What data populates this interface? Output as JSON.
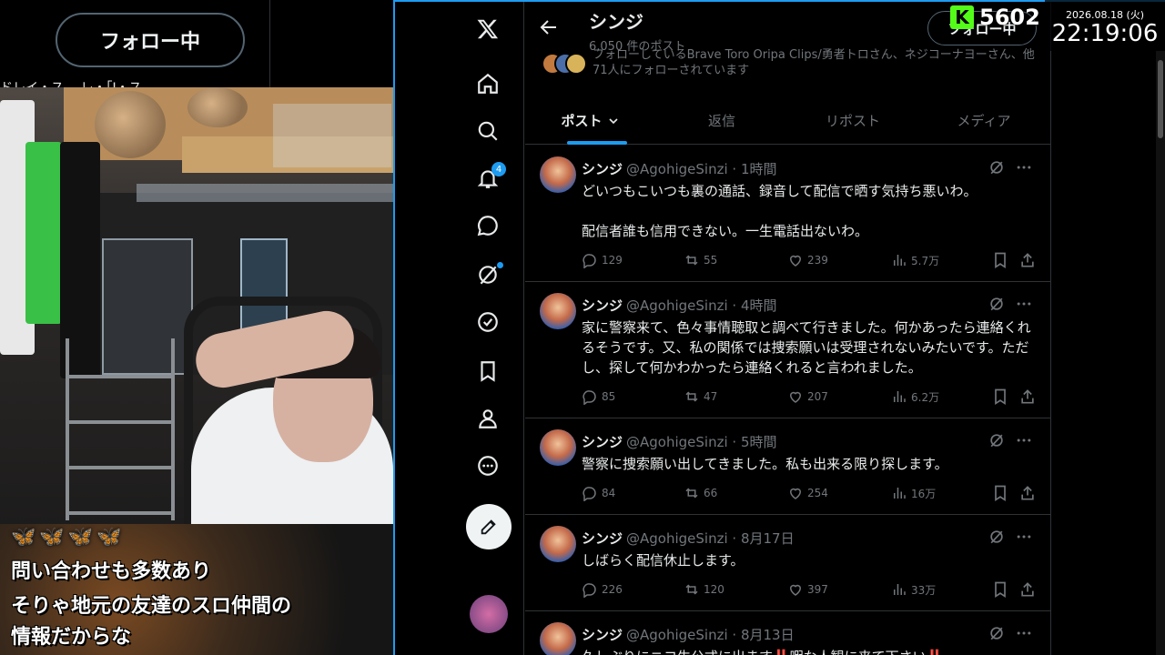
{
  "left_overlay": {
    "follow_label": "フォロー中",
    "cut_text": "ドレイ・ス… レ・「Ⅰ・ス"
  },
  "caption": {
    "icons": "🦋🦋🦋🦋",
    "lines": [
      "問い合わせも多数あり",
      "そりゃ地元の友達のスロ仲間の",
      "情報だからな"
    ]
  },
  "nav": {
    "notifications_badge": "4",
    "icons": [
      "x-logo-icon",
      "home-icon",
      "search-icon",
      "bell-icon",
      "message-icon",
      "grok-icon",
      "verified-icon",
      "bookmark-icon",
      "profile-icon",
      "more-icon"
    ]
  },
  "profile": {
    "name": "シンジ",
    "post_count": "6,050 件のポスト",
    "followed_by": "フォローしているBrave Toro Oripa Clips/勇者トロさん、ネジコーナヨーさん、他71人にフォローされています",
    "follow_button": "フォロー中"
  },
  "tabs": [
    {
      "label": "ポスト",
      "active": true
    },
    {
      "label": "返信",
      "active": false
    },
    {
      "label": "リポスト",
      "active": false
    },
    {
      "label": "メディア",
      "active": false
    }
  ],
  "tweets": [
    {
      "name": "シンジ",
      "meta": "@AgohigeSinzi · 1時間",
      "text": "どいつもこいつも裏の通話、録音して配信で晒す気持ち悪いわ。\n\n配信者誰も信用できない。一生電話出ないわ。",
      "replies": "129",
      "reposts": "55",
      "likes": "239",
      "views": "5.7万"
    },
    {
      "name": "シンジ",
      "meta": "@AgohigeSinzi · 4時間",
      "text": "家に警察来て、色々事情聴取と調べて行きました。何かあったら連絡くれるそうです。又、私の関係では捜索願いは受理されないみたいです。ただし、探して何かわかったら連絡くれると言われました。",
      "replies": "85",
      "reposts": "47",
      "likes": "207",
      "views": "6.2万"
    },
    {
      "name": "シンジ",
      "meta": "@AgohigeSinzi · 5時間",
      "text": "警察に捜索願い出してきました。私も出来る限り探します。",
      "replies": "84",
      "reposts": "66",
      "likes": "254",
      "views": "16万"
    },
    {
      "name": "シンジ",
      "meta": "@AgohigeSinzi · 8月17日",
      "text": "しばらく配信休止します。",
      "replies": "226",
      "reposts": "120",
      "likes": "397",
      "views": "33万"
    },
    {
      "name": "シンジ",
      "meta": "@AgohigeSinzi · 8月13日",
      "text": "久しぶりにニコ生公式に出ます‼️暇な人観に来て下さい‼️",
      "replies": "",
      "reposts": "",
      "likes": "",
      "views": ""
    }
  ],
  "counter": {
    "value": "5602",
    "logo": "K"
  },
  "clock": {
    "date": "2026.08.18 (火)",
    "time": "22:19:06"
  },
  "colors": {
    "accent": "#1d9bf0",
    "text": "#e7e9ea",
    "muted": "#71767b",
    "kick_green": "#53fc18"
  }
}
